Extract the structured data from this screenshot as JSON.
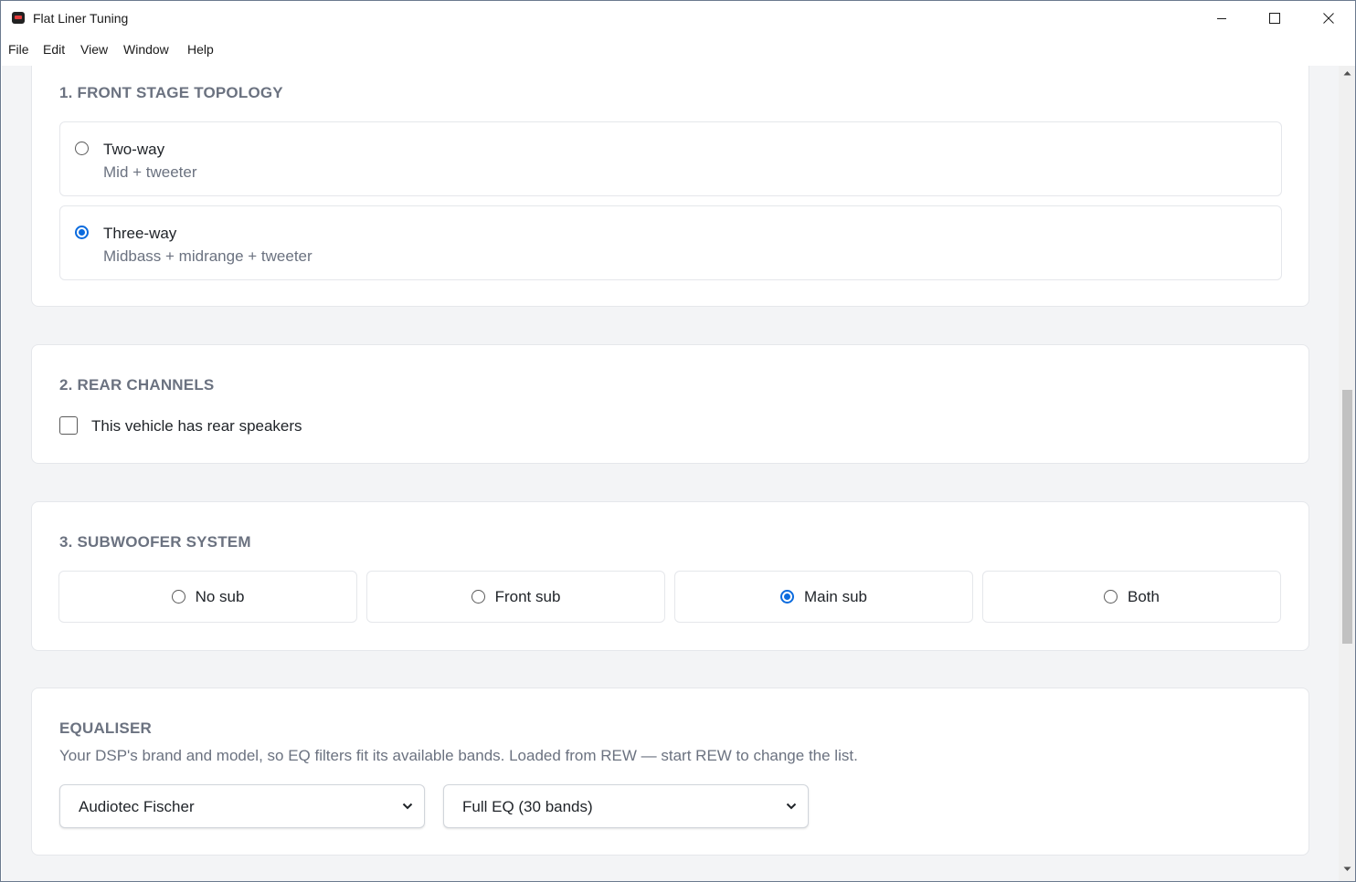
{
  "window": {
    "title": "Flat Liner Tuning"
  },
  "menu": [
    "File",
    "Edit",
    "View",
    "Window",
    "Help"
  ],
  "front_stage": {
    "title": "1. FRONT STAGE TOPOLOGY",
    "options": [
      {
        "label": "Two-way",
        "sub": "Mid + tweeter",
        "selected": false
      },
      {
        "label": "Three-way",
        "sub": "Midbass + midrange + tweeter",
        "selected": true
      }
    ]
  },
  "rear": {
    "title": "2. REAR CHANNELS",
    "checkbox_label": "This vehicle has rear speakers",
    "checked": false
  },
  "subwoofer": {
    "title": "3. SUBWOOFER SYSTEM",
    "options": [
      {
        "label": "No sub",
        "selected": false
      },
      {
        "label": "Front sub",
        "selected": false
      },
      {
        "label": "Main sub",
        "selected": true
      },
      {
        "label": "Both",
        "selected": false
      }
    ]
  },
  "equaliser": {
    "title": "EQUALISER",
    "description": "Your DSP's brand and model, so EQ filters fit its available bands. Loaded from REW — start REW to change the list.",
    "brand_value": "Audiotec Fischer",
    "model_value": "Full EQ (30 bands)"
  },
  "colors": {
    "accent": "#0b6bde",
    "background": "#f3f4f6",
    "section_title": "#6b7280"
  }
}
